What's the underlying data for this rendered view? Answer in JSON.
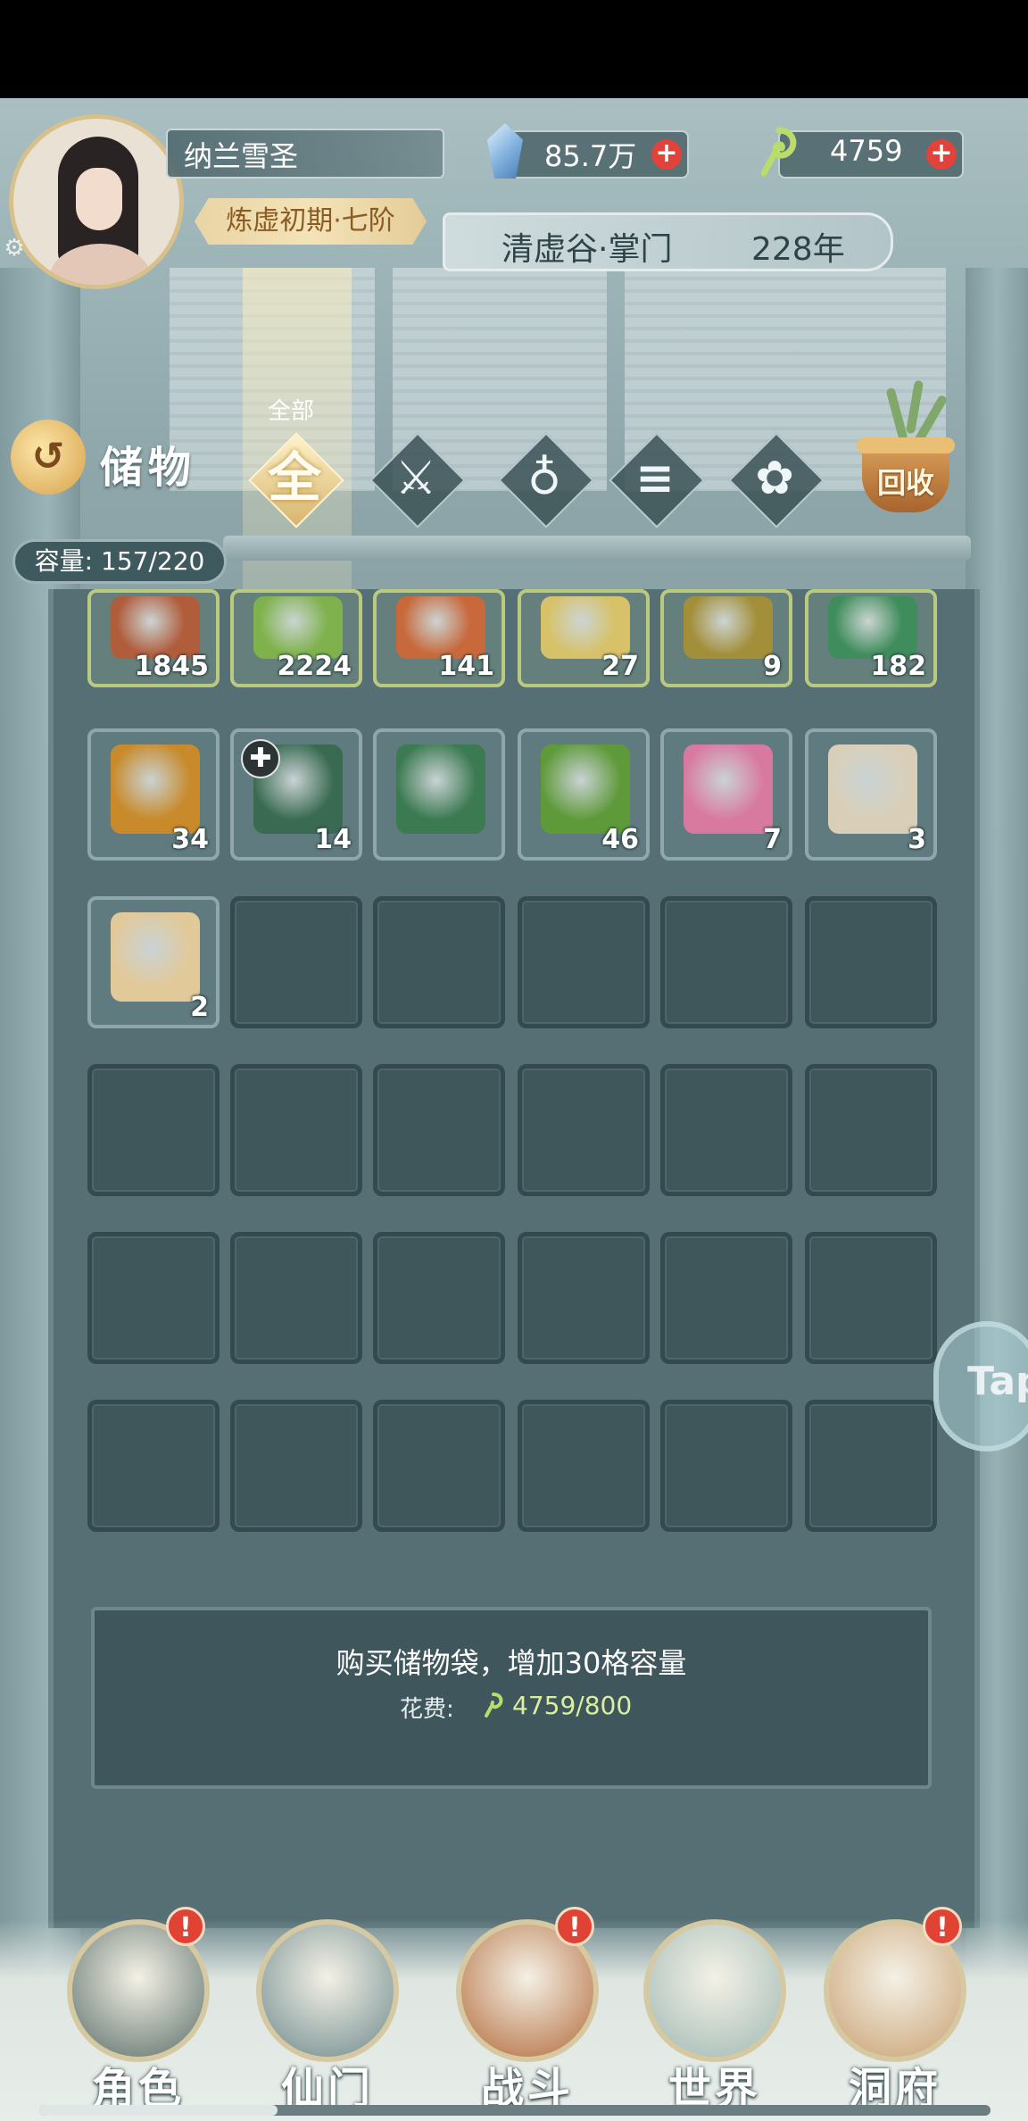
{
  "player": {
    "name": "纳兰雪圣",
    "realm": "炼虚初期·七阶"
  },
  "sect": {
    "name": "清虚谷·掌门",
    "age": "228年"
  },
  "resources": {
    "gems": {
      "value": "85.7万",
      "icon": "blue-crystal-icon"
    },
    "jade": {
      "value": "4759",
      "icon": "green-jade-icon"
    }
  },
  "storage": {
    "title": "储物",
    "tab_label": "全部",
    "tabs": [
      {
        "glyph": "全",
        "icon": "all-tab-icon"
      },
      {
        "glyph": "⚔",
        "icon": "weapon-tab-icon"
      },
      {
        "glyph": "♁",
        "icon": "gourd-tab-icon"
      },
      {
        "glyph": "≡",
        "icon": "scroll-tab-icon"
      },
      {
        "glyph": "✿",
        "icon": "herb-tab-icon"
      }
    ],
    "recycle_label": "回收",
    "capacity": "容量: 157/220"
  },
  "items": [
    {
      "qty": "1845",
      "icon": "red-ore-icon",
      "color": "#b05d3c"
    },
    {
      "qty": "2224",
      "icon": "grass-herb-icon",
      "color": "#7fb24c"
    },
    {
      "qty": "141",
      "icon": "meat-icon",
      "color": "#c8693c"
    },
    {
      "qty": "27",
      "icon": "golden-scroll-icon",
      "color": "#d7c26a"
    },
    {
      "qty": "9",
      "icon": "bronze-treasure-icon",
      "color": "#a38f3a"
    },
    {
      "qty": "182",
      "icon": "green-jade-ore-icon",
      "color": "#3f8d5c"
    },
    {
      "qty": "34",
      "icon": "golden-gourd-icon",
      "color": "#c88a2a"
    },
    {
      "qty": "14",
      "icon": "book-stack-icon",
      "color": "#3a6b52"
    },
    {
      "qty": "",
      "icon": "green-manual-icon",
      "color": "#3c7a52"
    },
    {
      "qty": "46",
      "icon": "herb-bundle-icon",
      "color": "#5f9a3a"
    },
    {
      "qty": "7",
      "icon": "peach-basket-icon",
      "color": "#d87aa0"
    },
    {
      "qty": "3",
      "icon": "secret-manual-icon",
      "color": "#d9cfb8"
    },
    {
      "qty": "2",
      "icon": "five-elements-scroll-icon",
      "color": "#e2c99a"
    }
  ],
  "buy": {
    "text": "购买储物袋，增加30格容量",
    "cost_label": "花费:",
    "cost_value": "4759/800"
  },
  "tap_label": "Tap",
  "nav": [
    {
      "label": "角色",
      "alert": "!",
      "color": "#5a6f6a"
    },
    {
      "label": "仙门",
      "alert": "",
      "color": "#6e8a8e"
    },
    {
      "label": "战斗",
      "alert": "!",
      "color": "#b36a3a"
    },
    {
      "label": "世界",
      "alert": "",
      "color": "#9fb9b4"
    },
    {
      "label": "洞府",
      "alert": "!",
      "color": "#c9a172"
    }
  ],
  "scroll_progress": 0.25
}
